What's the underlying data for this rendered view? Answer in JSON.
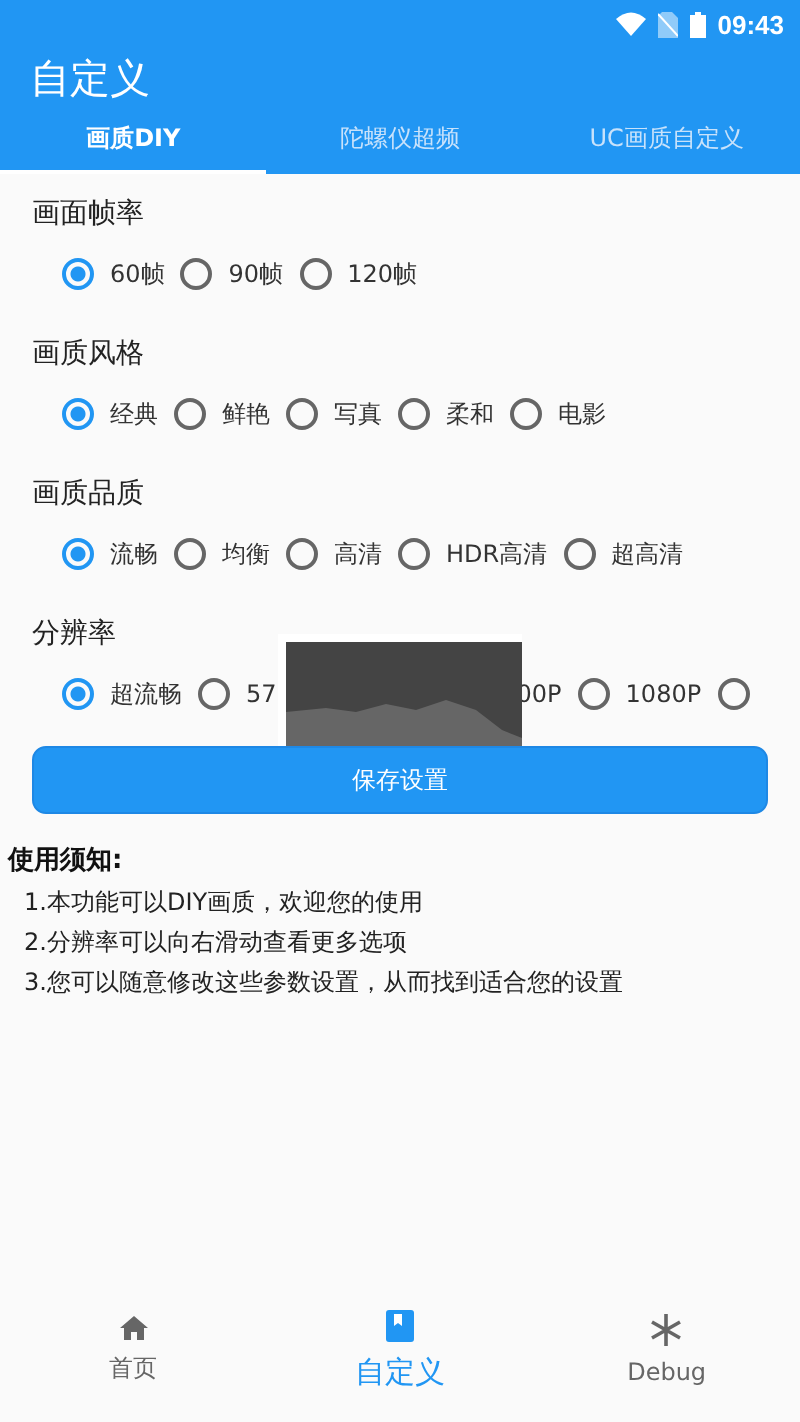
{
  "status_bar": {
    "time": "09:43"
  },
  "app_bar": {
    "title": "自定义"
  },
  "tabs": [
    {
      "label": "画质DIY",
      "selected": true
    },
    {
      "label": "陀螺仪超频",
      "selected": false
    },
    {
      "label": "UC画质自定义",
      "selected": false
    }
  ],
  "groups": [
    {
      "title": "画面帧率",
      "options": [
        {
          "kind": "option",
          "label": "60帧",
          "selected": true
        },
        {
          "kind": "option",
          "label": "90帧",
          "selected": false
        },
        {
          "kind": "option",
          "label": "120帧",
          "selected": false
        }
      ]
    },
    {
      "title": "画质风格",
      "options": [
        {
          "kind": "option",
          "label": "经典",
          "selected": true
        },
        {
          "kind": "option",
          "label": "鲜艳",
          "selected": false
        },
        {
          "kind": "option",
          "label": "写真",
          "selected": false
        },
        {
          "kind": "option",
          "label": "柔和",
          "selected": false
        },
        {
          "kind": "option",
          "label": "电影",
          "selected": false
        }
      ]
    },
    {
      "title": "画质品质",
      "options": [
        {
          "kind": "option",
          "label": "流畅",
          "selected": true
        },
        {
          "kind": "option",
          "label": "均衡",
          "selected": false
        },
        {
          "kind": "option",
          "label": "高清",
          "selected": false
        },
        {
          "kind": "option",
          "label": "HDR高清",
          "selected": false
        },
        {
          "kind": "option",
          "label": "超高清",
          "selected": false
        }
      ]
    },
    {
      "title": "分辨率",
      "options": [
        {
          "kind": "option",
          "label": "超流畅",
          "selected": true
        },
        {
          "kind": "option",
          "label": "57",
          "selected": false
        },
        {
          "kind": "hidden"
        },
        {
          "kind": "label",
          "label": "00P"
        },
        {
          "kind": "option",
          "label": "1080P",
          "selected": false
        },
        {
          "kind": "radio",
          "selected": false
        }
      ]
    }
  ],
  "save_button": "保存设置",
  "notice": {
    "title": "使用须知:",
    "lines": [
      "1.本功能可以DIY画质，欢迎您的使用",
      "2.分辨率可以向右滑动查看更多选项",
      "3.您可以随意修改这些参数设置，从而找到适合您的设置"
    ]
  },
  "bottom_nav": [
    {
      "kind": "home",
      "label": "首页",
      "selected": false
    },
    {
      "kind": "book",
      "label": "自定义",
      "selected": true
    },
    {
      "kind": "snowflake",
      "label": "Debug",
      "selected": false
    }
  ]
}
